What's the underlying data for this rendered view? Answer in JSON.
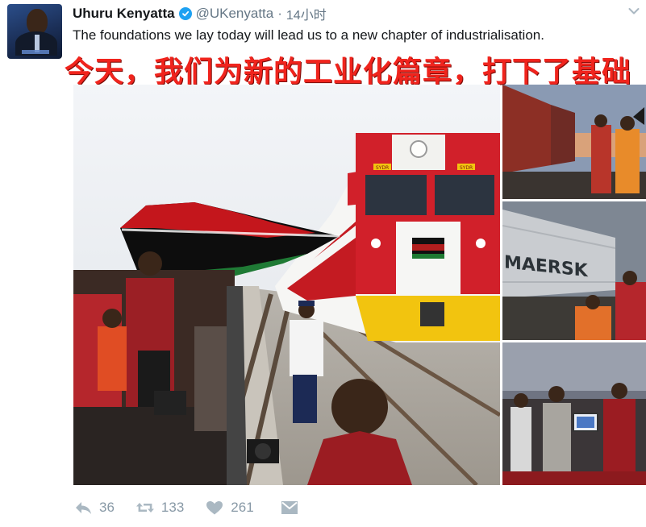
{
  "author": {
    "display_name": "Uhuru Kenyatta",
    "handle": "@UKenyatta",
    "separator": "·",
    "time": "14小时",
    "verified": true
  },
  "tweet": {
    "text": "The foundations we lay today will lead us to a new chapter of industrialisation.",
    "overlay_caption": "今天，我们为新的工业化篇章，打下了基础"
  },
  "media": {
    "main_image_text": {
      "locomotive_number_left": "SYDR",
      "locomotive_number_right": "SYDR"
    },
    "thumb2_container_text": "MAERSK"
  },
  "actions": {
    "reply_count": "36",
    "retweet_count": "133",
    "like_count": "261"
  },
  "icons": {
    "verified": "verified-badge-icon",
    "caret": "chevron-down-icon",
    "reply": "reply-icon",
    "retweet": "retweet-icon",
    "like": "heart-icon",
    "dm": "direct-message-icon"
  },
  "colors": {
    "verified": "#1da1f2",
    "caption_red": "#f0241d",
    "muted": "#8899a6",
    "train_red": "#d1202a",
    "train_yellow": "#f2c40f"
  }
}
